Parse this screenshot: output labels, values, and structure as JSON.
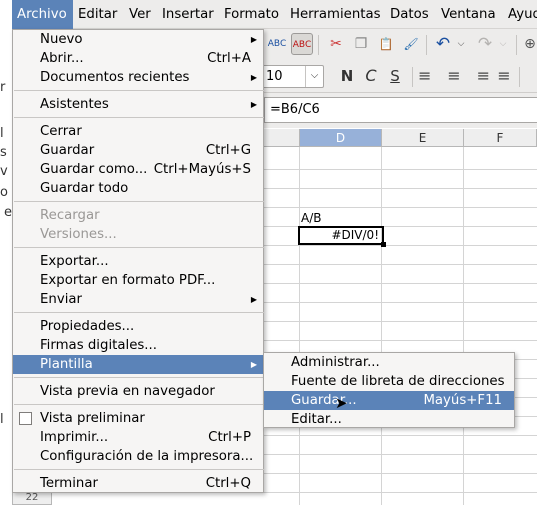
{
  "menubar": {
    "items": [
      "Archivo",
      "Editar",
      "Ver",
      "Insertar",
      "Formato",
      "Herramientas",
      "Datos",
      "Ventana",
      "Ayuda"
    ]
  },
  "toolbar": {
    "font_size": "10",
    "dropdown_glyph": "⌵",
    "buttons": {
      "spellcheck": "ABC",
      "autospell": "ABC",
      "cut": "✂",
      "copy": "❐",
      "paste": "📋",
      "clone": "🖌",
      "undo": "↶",
      "redo": "↷",
      "bold": "N",
      "italic": "C",
      "underline": "S",
      "align_left": "≡",
      "align_center": "≡",
      "align_right": "≡",
      "justify": "≡"
    }
  },
  "formula_bar": {
    "content": "=B6/C6"
  },
  "sheet": {
    "columns": [
      "D",
      "E",
      "F"
    ],
    "cell_d5": "A/B",
    "cell_d6": "#DIV/0!",
    "row_label_bottom": "22",
    "left_glyphs": [
      "r",
      "l",
      "s",
      "v",
      "o",
      "e",
      "l"
    ]
  },
  "file_menu": {
    "items": [
      {
        "label": "Nuevo",
        "shortcut": "",
        "submenu": true
      },
      {
        "label": "Abrir...",
        "shortcut": "Ctrl+A"
      },
      {
        "label": "Documentos recientes",
        "submenu": true
      },
      {
        "label": "Asistentes",
        "submenu": true
      },
      {
        "label": "Cerrar"
      },
      {
        "label": "Guardar",
        "shortcut": "Ctrl+G"
      },
      {
        "label": "Guardar como...",
        "shortcut": "Ctrl+Mayús+S"
      },
      {
        "label": "Guardar todo"
      },
      {
        "label": "Recargar",
        "disabled": true
      },
      {
        "label": "Versiones...",
        "disabled": true
      },
      {
        "label": "Exportar..."
      },
      {
        "label": "Exportar en formato PDF..."
      },
      {
        "label": "Enviar",
        "submenu": true
      },
      {
        "label": "Propiedades..."
      },
      {
        "label": "Firmas digitales..."
      },
      {
        "label": "Plantilla",
        "submenu": true,
        "highlighted": true
      },
      {
        "label": "Vista previa en navegador"
      },
      {
        "label": "Vista preliminar",
        "checkbox": true
      },
      {
        "label": "Imprimir...",
        "shortcut": "Ctrl+P"
      },
      {
        "label": "Configuración de la impresora..."
      },
      {
        "label": "Terminar",
        "shortcut": "Ctrl+Q"
      }
    ]
  },
  "template_submenu": {
    "items": [
      {
        "label": "Administrar..."
      },
      {
        "label": "Fuente de libreta de direcciones"
      },
      {
        "label": "Guardar...",
        "shortcut": "Mayús+F11",
        "highlighted": true
      },
      {
        "label": "Editar..."
      }
    ]
  },
  "colors": {
    "highlight": "#5b83b8",
    "menu_bg": "#f6f5f4",
    "chrome_bg": "#edeceb"
  }
}
